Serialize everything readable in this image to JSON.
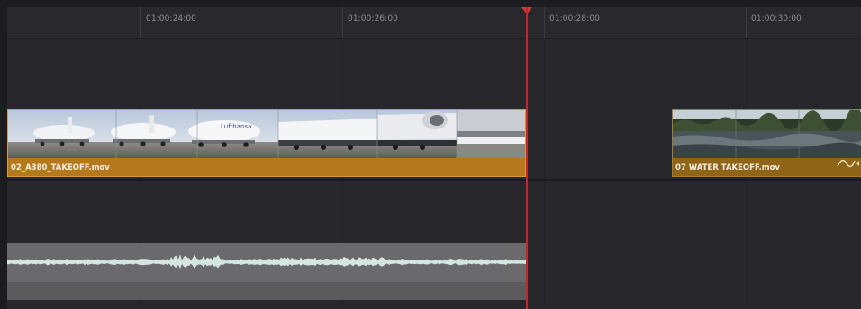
{
  "timeline": {
    "timecodes": [
      "01:00:24:00",
      "01:00:26:00",
      "01:00:28:00",
      "01:00:30:00"
    ]
  },
  "clips": {
    "a380": {
      "name": "02_A380_TAKEOFF.mov"
    },
    "water": {
      "name": "07 WATER TAKEOFF.mov"
    }
  },
  "colors": {
    "clip_selected": "#b5781d",
    "clip_normal": "#8f6417",
    "playhead": "#c2262e",
    "waveform": "#d4e6df"
  },
  "icons": [
    "playhead-icon",
    "retime-curve-icon",
    "keyframe-icon"
  ]
}
